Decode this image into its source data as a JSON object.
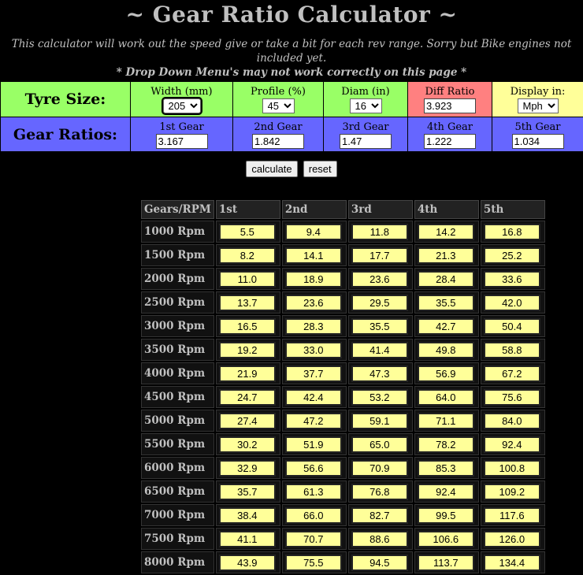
{
  "title": "~ Gear Ratio Calculator ~",
  "intro": {
    "line1": "This calculator will work out the speed give or take a bit for each rev range. Sorry but Bike engines not included yet.",
    "line2": "* Drop Down Menu's may not work correctly on this page *"
  },
  "tyre": {
    "label": "Tyre Size:",
    "width": {
      "caption": "Width (mm)",
      "value": "205"
    },
    "profile": {
      "caption": "Profile (%)",
      "value": "45"
    },
    "diam": {
      "caption": "Diam (in)",
      "value": "16"
    },
    "diff": {
      "caption": "Diff Ratio",
      "value": "3.923"
    },
    "display": {
      "caption": "Display in:",
      "value": "Mph"
    }
  },
  "gears": {
    "label": "Gear Ratios:",
    "items": [
      {
        "caption": "1st Gear",
        "value": "3.167"
      },
      {
        "caption": "2nd Gear",
        "value": "1.842"
      },
      {
        "caption": "3rd Gear",
        "value": "1.47"
      },
      {
        "caption": "4th Gear",
        "value": "1.222"
      },
      {
        "caption": "5th Gear",
        "value": "1.034"
      }
    ]
  },
  "buttons": {
    "calculate": "calculate",
    "reset": "reset"
  },
  "results": {
    "headers": [
      "Gears/RPM",
      "1st",
      "2nd",
      "3rd",
      "4th",
      "5th"
    ],
    "rows": [
      {
        "rpm": "1000  Rpm",
        "values": [
          "5.5",
          "9.4",
          "11.8",
          "14.2",
          "16.8"
        ]
      },
      {
        "rpm": "1500  Rpm",
        "values": [
          "8.2",
          "14.1",
          "17.7",
          "21.3",
          "25.2"
        ]
      },
      {
        "rpm": "2000  Rpm",
        "values": [
          "11.0",
          "18.9",
          "23.6",
          "28.4",
          "33.6"
        ]
      },
      {
        "rpm": "2500  Rpm",
        "values": [
          "13.7",
          "23.6",
          "29.5",
          "35.5",
          "42.0"
        ]
      },
      {
        "rpm": "3000  Rpm",
        "values": [
          "16.5",
          "28.3",
          "35.5",
          "42.7",
          "50.4"
        ]
      },
      {
        "rpm": "3500  Rpm",
        "values": [
          "19.2",
          "33.0",
          "41.4",
          "49.8",
          "58.8"
        ]
      },
      {
        "rpm": "4000  Rpm",
        "values": [
          "21.9",
          "37.7",
          "47.3",
          "56.9",
          "67.2"
        ]
      },
      {
        "rpm": "4500  Rpm",
        "values": [
          "24.7",
          "42.4",
          "53.2",
          "64.0",
          "75.6"
        ]
      },
      {
        "rpm": "5000  Rpm",
        "values": [
          "27.4",
          "47.2",
          "59.1",
          "71.1",
          "84.0"
        ]
      },
      {
        "rpm": "5500  Rpm",
        "values": [
          "30.2",
          "51.9",
          "65.0",
          "78.2",
          "92.4"
        ]
      },
      {
        "rpm": "6000  Rpm",
        "values": [
          "32.9",
          "56.6",
          "70.9",
          "85.3",
          "100.8"
        ]
      },
      {
        "rpm": "6500  Rpm",
        "values": [
          "35.7",
          "61.3",
          "76.8",
          "92.4",
          "109.2"
        ]
      },
      {
        "rpm": "7000  Rpm",
        "values": [
          "38.4",
          "66.0",
          "82.7",
          "99.5",
          "117.6"
        ]
      },
      {
        "rpm": "7500  Rpm",
        "values": [
          "41.1",
          "70.7",
          "88.6",
          "106.6",
          "126.0"
        ]
      },
      {
        "rpm": "8000  Rpm",
        "values": [
          "43.9",
          "75.5",
          "94.5",
          "113.7",
          "134.4"
        ]
      }
    ]
  }
}
